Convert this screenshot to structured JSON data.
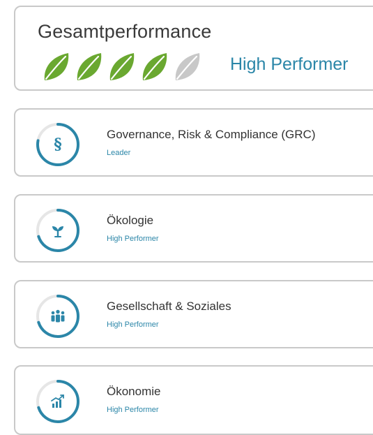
{
  "overall": {
    "title": "Gesamtperformance",
    "status": "High Performer",
    "rating": 4,
    "rating_max": 5,
    "leaf_colors": {
      "filled": "#6aa830",
      "empty": "#c8c8c8"
    }
  },
  "categories": [
    {
      "title": "Governance, Risk & Compliance (GRC)",
      "status": "Leader",
      "icon": "paragraph-icon",
      "gauge_level": 0.78
    },
    {
      "title": "Ökologie",
      "status": "High Performer",
      "icon": "plant-icon",
      "gauge_level": 0.7
    },
    {
      "title": "Gesellschaft & Soziales",
      "status": "High Performer",
      "icon": "people-icon",
      "gauge_level": 0.7
    },
    {
      "title": "Ökonomie",
      "status": "High Performer",
      "icon": "growth-chart-icon",
      "gauge_level": 0.7
    }
  ],
  "colors": {
    "accent": "#2b86a8",
    "track": "#e6e6e6",
    "border": "#c9c9c9"
  }
}
